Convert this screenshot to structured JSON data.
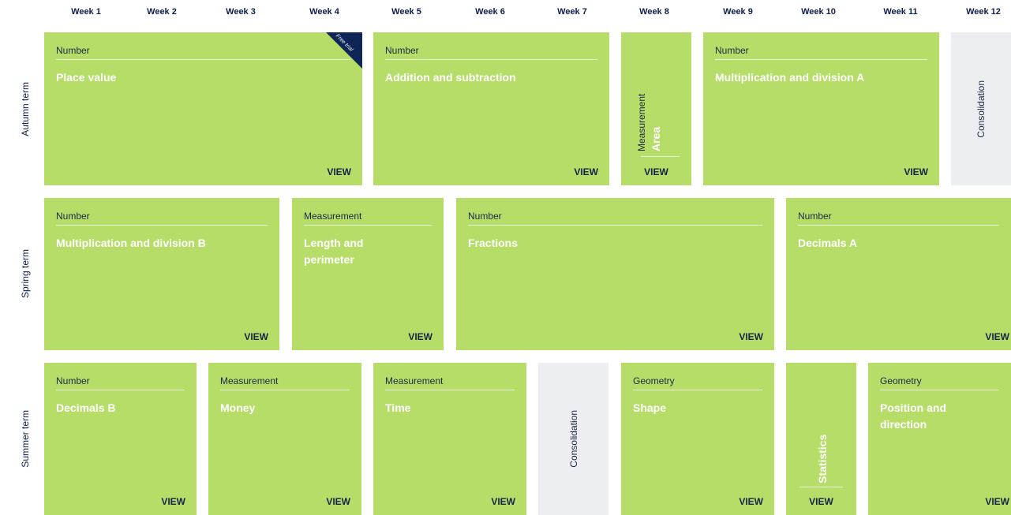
{
  "weeks": [
    "Week 1",
    "Week 2",
    "Week 3",
    "Week 4",
    "Week 5",
    "Week 6",
    "Week 7",
    "Week 8",
    "Week 9",
    "Week 10",
    "Week 11",
    "Week 12"
  ],
  "terms": {
    "autumn": "Autumn term",
    "spring": "Spring term",
    "summer": "Summer term"
  },
  "view_label": "VIEW",
  "autumn": {
    "place_value": {
      "category": "Number",
      "title": "Place value",
      "badge": "Free trial"
    },
    "addition_subtraction": {
      "category": "Number",
      "title": "Addition and subtraction"
    },
    "area": {
      "category": "Measurement",
      "title": "Area"
    },
    "mult_div_a": {
      "category": "Number",
      "title": "Multiplication and division A"
    },
    "consolidation": "Consolidation"
  },
  "spring": {
    "mult_div_b": {
      "category": "Number",
      "title": "Multiplication and division B"
    },
    "length_perimeter": {
      "category": "Measurement",
      "title": "Length and perimeter"
    },
    "fractions": {
      "category": "Number",
      "title": "Fractions"
    },
    "decimals_a": {
      "category": "Number",
      "title": "Decimals A"
    }
  },
  "summer": {
    "decimals_b": {
      "category": "Number",
      "title": "Decimals B"
    },
    "money": {
      "category": "Measurement",
      "title": "Money"
    },
    "time": {
      "category": "Measurement",
      "title": "Time"
    },
    "consolidation": "Consolidation",
    "shape": {
      "category": "Geometry",
      "title": "Shape"
    },
    "statistics": {
      "title": "Statistics"
    },
    "position_direction": {
      "category": "Geometry",
      "title": "Position and direction"
    }
  },
  "colors": {
    "block": "#b5dd67",
    "consolidation": "#eceef1",
    "navy": "#0d2557"
  }
}
